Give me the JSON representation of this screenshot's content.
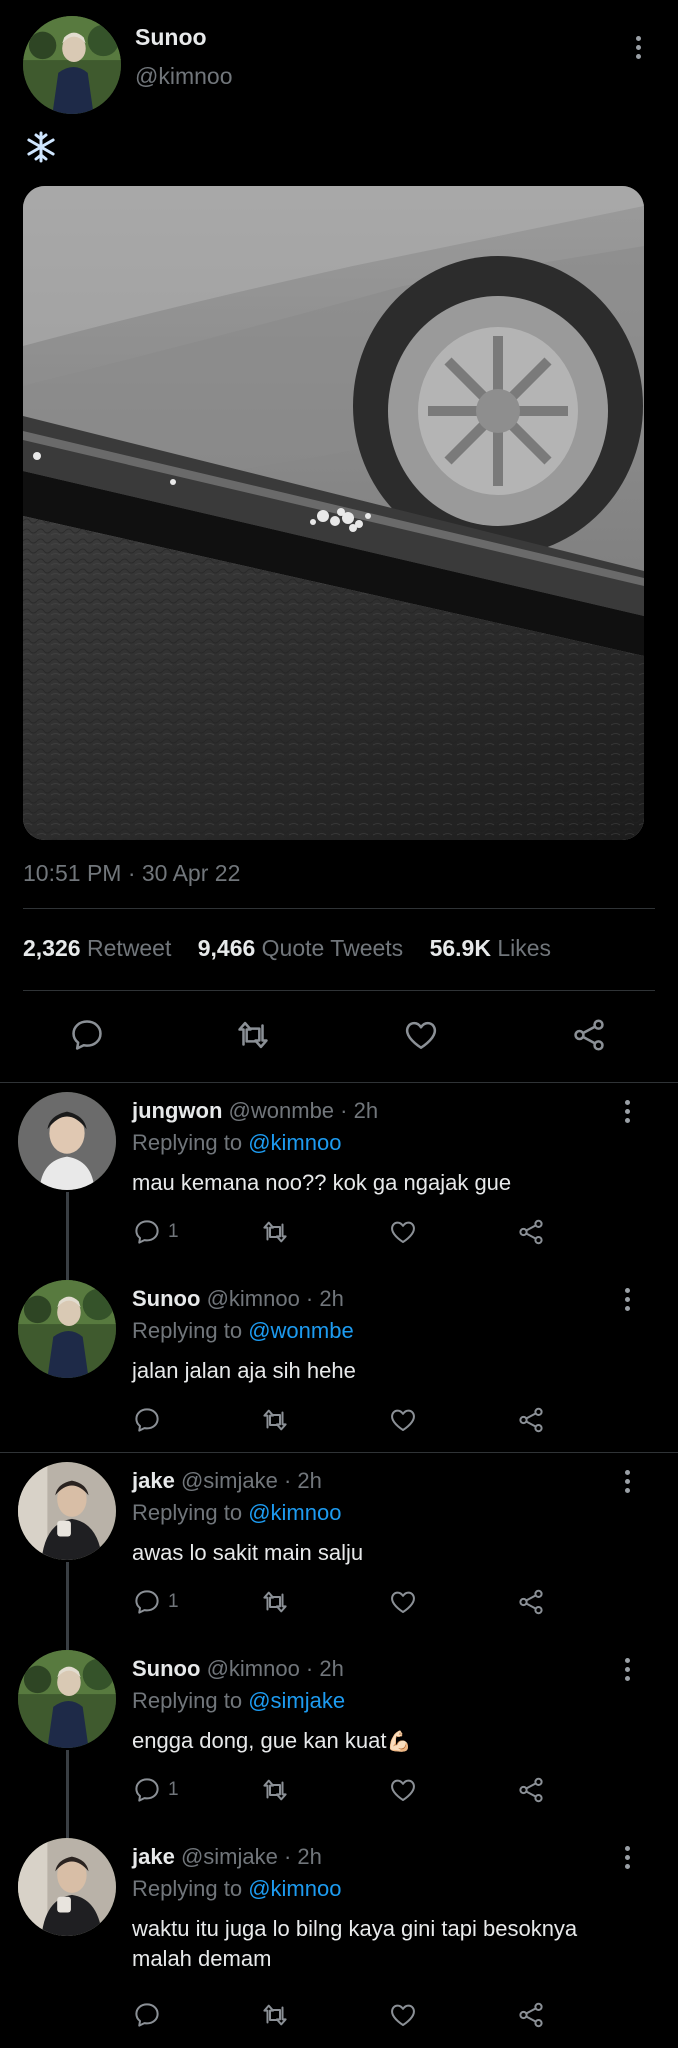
{
  "tweet": {
    "author_name": "Sunoo",
    "author_handle": "@kimnoo",
    "text_emoji": "❄️",
    "timestamp": "10:51 PM · 30 Apr 22",
    "stats": {
      "retweets": "2,326",
      "retweets_label": "Retweet",
      "quotes": "9,466",
      "quotes_label": "Quote Tweets",
      "likes": "56.9K",
      "likes_label": "Likes"
    },
    "icons": [
      "reply-icon",
      "retweet-icon",
      "like-icon",
      "share-icon"
    ]
  },
  "replies": [
    {
      "name": "jungwon",
      "handle_time": "@wonmbe · 2h",
      "replying_prefix": "Replying to",
      "replying_to": "@kimnoo",
      "text": "mau kemana noo?? kok ga ngajak gue",
      "reply_count": "1"
    },
    {
      "name": "Sunoo",
      "handle_time": "@kimnoo · 2h",
      "replying_prefix": "Replying to",
      "replying_to": "@wonmbe",
      "text": "jalan jalan aja sih hehe",
      "reply_count": ""
    },
    {
      "name": "jake",
      "handle_time": "@simjake · 2h",
      "replying_prefix": "Replying to",
      "replying_to": "@kimnoo",
      "text": "awas lo sakit main salju",
      "reply_count": "1"
    },
    {
      "name": "Sunoo",
      "handle_time": "@kimnoo · 2h",
      "replying_prefix": "Replying to",
      "replying_to": "@simjake",
      "text": "engga dong, gue kan kuat",
      "text_emoji": "💪🏻",
      "reply_count": "1"
    },
    {
      "name": "jake",
      "handle_time": "@simjake · 2h",
      "replying_prefix": "Replying to",
      "replying_to": "@kimnoo",
      "text": "waktu itu juga lo bilng kaya gini tapi besoknya malah demam",
      "reply_count": ""
    }
  ],
  "colors": {
    "background": "#000000",
    "text": "#e7e9ea",
    "muted": "#71767b",
    "mention": "#1d9bf0",
    "divider": "#2f3336"
  }
}
